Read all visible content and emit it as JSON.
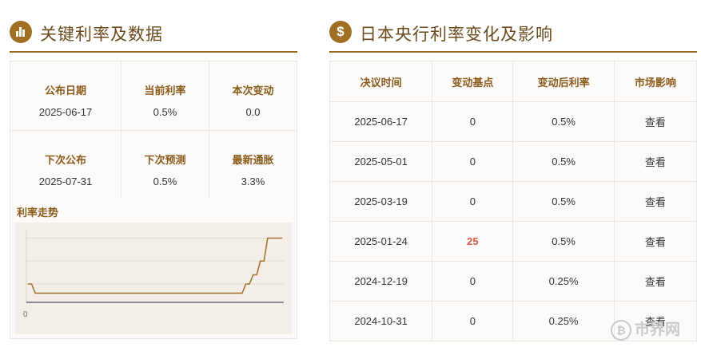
{
  "left": {
    "title": "关键利率及数据",
    "icon": "bar-chart-icon",
    "stats_row1": [
      {
        "label": "公布日期",
        "value": "2025-06-17"
      },
      {
        "label": "当前利率",
        "value": "0.5%"
      },
      {
        "label": "本次变动",
        "value": "0.0"
      }
    ],
    "stats_row2": [
      {
        "label": "下次公布",
        "value": "2025-07-31"
      },
      {
        "label": "下次预测",
        "value": "0.5%"
      },
      {
        "label": "最新通胀",
        "value": "3.3%"
      }
    ],
    "trend_title": "利率走势"
  },
  "right": {
    "title": "日本央行利率变化及影响",
    "icon": "dollar-icon",
    "headers": [
      "决议时间",
      "变动基点",
      "变动后利率",
      "市场影响"
    ],
    "rows": [
      {
        "date": "2025-06-17",
        "bp": "0",
        "rate": "0.5%",
        "impact": "查看"
      },
      {
        "date": "2025-05-01",
        "bp": "0",
        "rate": "0.5%",
        "impact": "查看"
      },
      {
        "date": "2025-03-19",
        "bp": "0",
        "rate": "0.5%",
        "impact": "查看"
      },
      {
        "date": "2025-01-24",
        "bp": "25",
        "rate": "0.5%",
        "impact": "查看"
      },
      {
        "date": "2024-12-19",
        "bp": "0",
        "rate": "0.25%",
        "impact": "查看"
      },
      {
        "date": "2024-10-31",
        "bp": "0",
        "rate": "0.25%",
        "impact": "查看"
      }
    ]
  },
  "watermark": "市界网",
  "colors": {
    "accent": "#a06f23",
    "label": "#8a5b1b",
    "line": "#a0702a",
    "highlight": "#d85a4a"
  },
  "chart_data": {
    "type": "line",
    "title": "",
    "xlabel": "",
    "ylabel": "",
    "y_tick_labels": [
      "0"
    ],
    "ylim": [
      -0.2,
      0.6
    ],
    "series": [
      {
        "name": "",
        "values": [
          0.0,
          0.0,
          -0.1,
          -0.1,
          -0.1,
          -0.1,
          -0.1,
          -0.1,
          -0.1,
          -0.1,
          -0.1,
          -0.1,
          -0.1,
          -0.1,
          -0.1,
          -0.1,
          -0.1,
          -0.1,
          -0.1,
          -0.1,
          -0.1,
          -0.1,
          -0.1,
          -0.1,
          -0.1,
          -0.1,
          -0.1,
          -0.1,
          -0.1,
          -0.1,
          -0.1,
          -0.1,
          -0.1,
          -0.1,
          -0.1,
          -0.1,
          -0.1,
          -0.1,
          -0.1,
          -0.1,
          -0.1,
          -0.1,
          -0.1,
          -0.1,
          -0.1,
          -0.1,
          -0.1,
          -0.1,
          -0.1,
          -0.1,
          -0.1,
          -0.1,
          -0.1,
          -0.1,
          -0.1,
          -0.1,
          -0.1,
          -0.1,
          -0.1,
          -0.1,
          0.0,
          0.0,
          0.1,
          0.1,
          0.25,
          0.25,
          0.5,
          0.5,
          0.5,
          0.5,
          0.5
        ]
      }
    ]
  }
}
